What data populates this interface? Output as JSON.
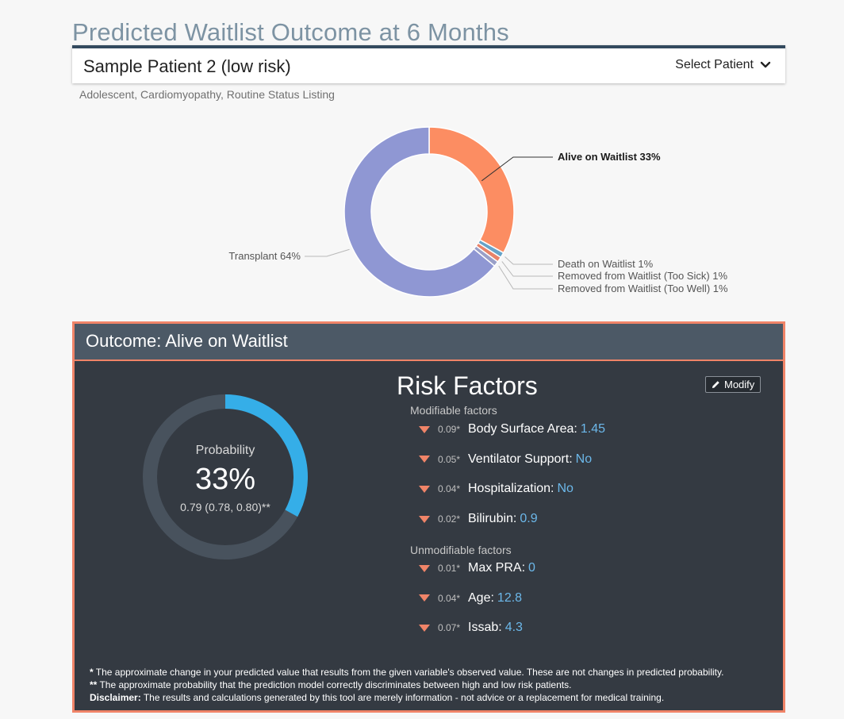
{
  "page_title": "Predicted Waitlist Outcome at 6 Months",
  "patient": {
    "name": "Sample Patient 2 (low risk)",
    "select_label": "Select Patient",
    "description": "Adolescent, Cardiomyopathy, Routine Status Listing"
  },
  "chart_data": {
    "type": "pie",
    "style": "donut",
    "slices": [
      {
        "label": "Alive on Waitlist 33%",
        "value": 33,
        "color": "#fc8d62"
      },
      {
        "label": "Death on Waitlist 1%",
        "value": 1,
        "color": "#66a3c8"
      },
      {
        "label": "Removed from Waitlist (Too Sick) 1%",
        "value": 1,
        "color": "#e8836a"
      },
      {
        "label": "Removed from Waitlist (Too Well) 1%",
        "value": 1,
        "color": "#9aa0c8"
      },
      {
        "label": "Transplant 64%",
        "value": 64,
        "color": "#8f97d3"
      }
    ]
  },
  "outcome": {
    "title": "Outcome: Alive on Waitlist",
    "probability_label": "Probability",
    "probability_value": "33%",
    "probability_fraction": 0.33,
    "concordance": "0.79 (0.78, 0.80)**",
    "ring_color": "#35aee8",
    "ring_track_color": "#48525d"
  },
  "risk_factors": {
    "title": "Risk Factors",
    "modify_label": "Modify",
    "modifiable_label": "Modifiable factors",
    "unmodifiable_label": "Unmodifiable factors",
    "modifiable": [
      {
        "delta": "0.09*",
        "name": "Body Surface Area:",
        "value": "1.45"
      },
      {
        "delta": "0.05*",
        "name": "Ventilator Support:",
        "value": "No"
      },
      {
        "delta": "0.04*",
        "name": "Hospitalization:",
        "value": "No"
      },
      {
        "delta": "0.02*",
        "name": "Bilirubin:",
        "value": "0.9"
      }
    ],
    "unmodifiable": [
      {
        "delta": "0.01*",
        "name": "Max PRA:",
        "value": "0"
      },
      {
        "delta": "0.04*",
        "name": "Age:",
        "value": "12.8"
      },
      {
        "delta": "0.07*",
        "name": "Issab:",
        "value": "4.3"
      }
    ],
    "arrow_color": "#f08468"
  },
  "footnotes": {
    "n1_marker": "*",
    "n1_text": " The approximate change in your predicted value that results from the given variable's observed value. These are not changes in predicted probability.",
    "n2_marker": "**",
    "n2_text": " The approximate probability that the prediction model correctly discriminates between high and low risk patients.",
    "n3_marker": "Disclaimer:",
    "n3_text": " The results and calculations generated by this tool are merely information - not advice or a replacement for medical training."
  }
}
